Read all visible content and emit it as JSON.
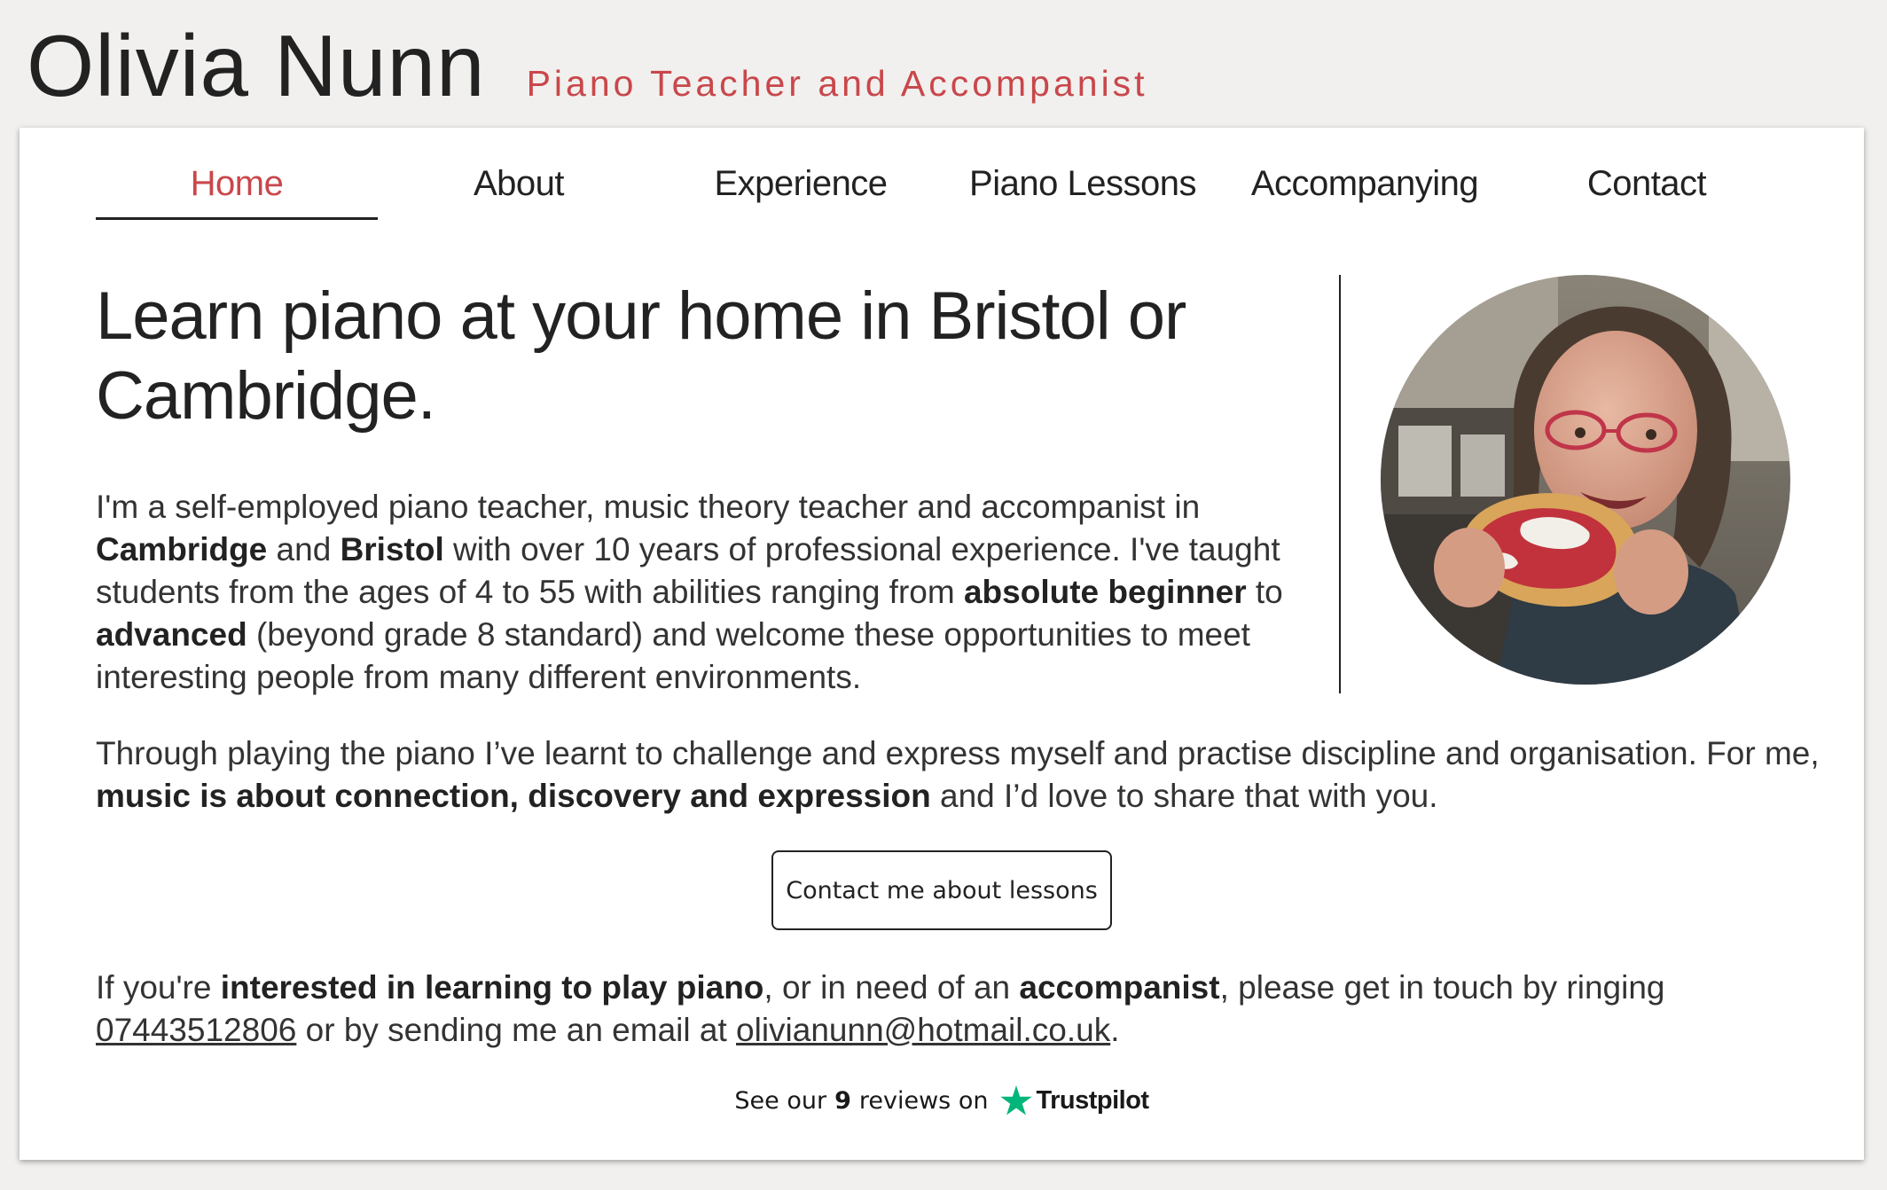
{
  "header": {
    "title": "Olivia Nunn",
    "subtitle": "Piano Teacher and Accompanist"
  },
  "nav": {
    "items": [
      {
        "label": "Home"
      },
      {
        "label": "About"
      },
      {
        "label": "Experience"
      },
      {
        "label": "Piano Lessons"
      },
      {
        "label": "Accompanying"
      },
      {
        "label": "Contact"
      }
    ],
    "active": "Home"
  },
  "main": {
    "headline": "Learn piano at your home in Bristol or Cambridge.",
    "intro": {
      "t1": "I'm a self-employed piano teacher, music theory teacher and accompanist in ",
      "b1": "Cambridge",
      "t2": " and ",
      "b2": "Bristol",
      "t3": " with over 10 years of professional experience. I've taught students from the ages of 4 to 55 with abilities ranging from ",
      "b3": "absolute beginner",
      "t4": " to ",
      "b4": "advanced",
      "t5": " (beyond grade 8 standard) and welcome these opportunities to meet interesting people from many different environments."
    },
    "philosophy": {
      "t1": "Through playing the piano I’ve learnt to challenge and express myself and practise discipline and organisation. For me, ",
      "b1": "music is about connection, discovery and expression",
      "t2": " and I’d love to share that with you."
    },
    "cta_label": "Contact me about lessons",
    "contact": {
      "t1": "If you're ",
      "b1": "interested in learning to play piano",
      "t2": ", or in need of an ",
      "b2": "accompanist",
      "t3": ", please get in touch by ringing ",
      "phone": "07443512806",
      "t4": " or by sending me an email at ",
      "email": "olivianunn@hotmail.co.uk",
      "t5": "."
    },
    "photo_alt": "Photo of Olivia eating a jam and cream pastry"
  },
  "reviews": {
    "prefix": "See our",
    "count": "9",
    "suffix": "reviews on",
    "brand": "Trustpilot",
    "star_color": "#00b67a"
  },
  "colors": {
    "accent": "#c9474b",
    "background": "#f1f0ee",
    "card": "#ffffff"
  }
}
